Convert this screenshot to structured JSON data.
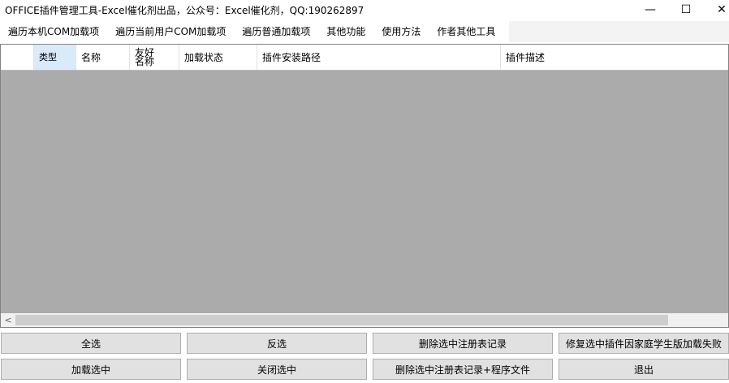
{
  "window": {
    "title": "OFFICE插件管理工具-Excel催化剂出品，公众号：Excel催化剂，QQ:190262897",
    "minimize_glyph": "—",
    "maximize_glyph": "☐",
    "close_glyph": "✕"
  },
  "menu": {
    "items": [
      "遍历本机COM加载项",
      "遍历当前用户COM加载项",
      "遍历普通加载项",
      "其他功能",
      "使用方法",
      "作者其他工具"
    ]
  },
  "grid": {
    "columns": [
      "类型",
      "名称",
      "友好名称",
      "加载状态",
      "插件安装路径",
      "插件描述"
    ],
    "scroll_left_glyph": "<"
  },
  "buttons": {
    "select_all": "全选",
    "invert": "反选",
    "delete_registry": "删除选中注册表记录",
    "repair": "修复选中插件因家庭学生版加载失败",
    "load_selected": "加载选中",
    "close_selected": "关闭选中",
    "delete_registry_files": "删除选中注册表记录+程序文件",
    "exit": "退出"
  },
  "colors": {
    "grid_background": "#ababab",
    "button_face": "#e1e1e1",
    "selected_header": "#d9ebfb"
  }
}
